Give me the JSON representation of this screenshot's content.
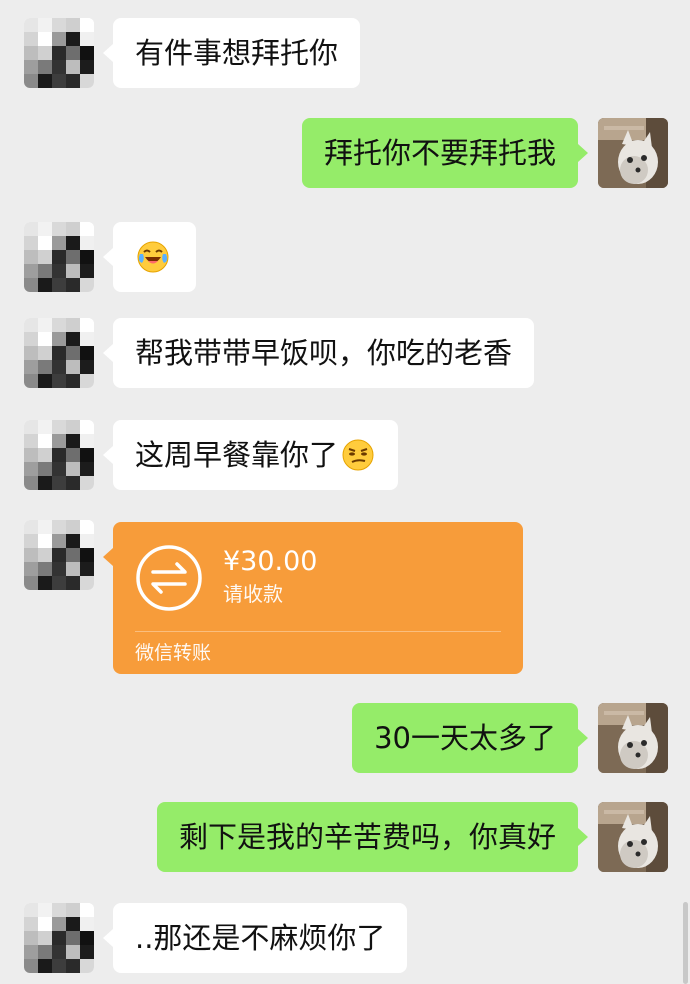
{
  "messages": {
    "m1": "有件事想拜托你",
    "m2": "拜托你不要拜托我",
    "m4": "帮我带带早饭呗，你吃的老香",
    "m5": "这周早餐靠你了",
    "m7": "30一天太多了",
    "m8": "剩下是我的辛苦费吗，你真好",
    "m9": "..那还是不麻烦你了"
  },
  "transfer": {
    "amount": "¥30.00",
    "status": "请收款",
    "footer": "微信转账"
  },
  "colors": {
    "background": "#ededed",
    "sent_bubble": "#95ec69",
    "received_bubble": "#ffffff",
    "transfer_card": "#f79c3a"
  },
  "icons": {
    "m3_emoji": "crying-laughing-emoji",
    "m5_emoji": "smirk-emoji",
    "transfer": "transfer-arrows-icon"
  }
}
